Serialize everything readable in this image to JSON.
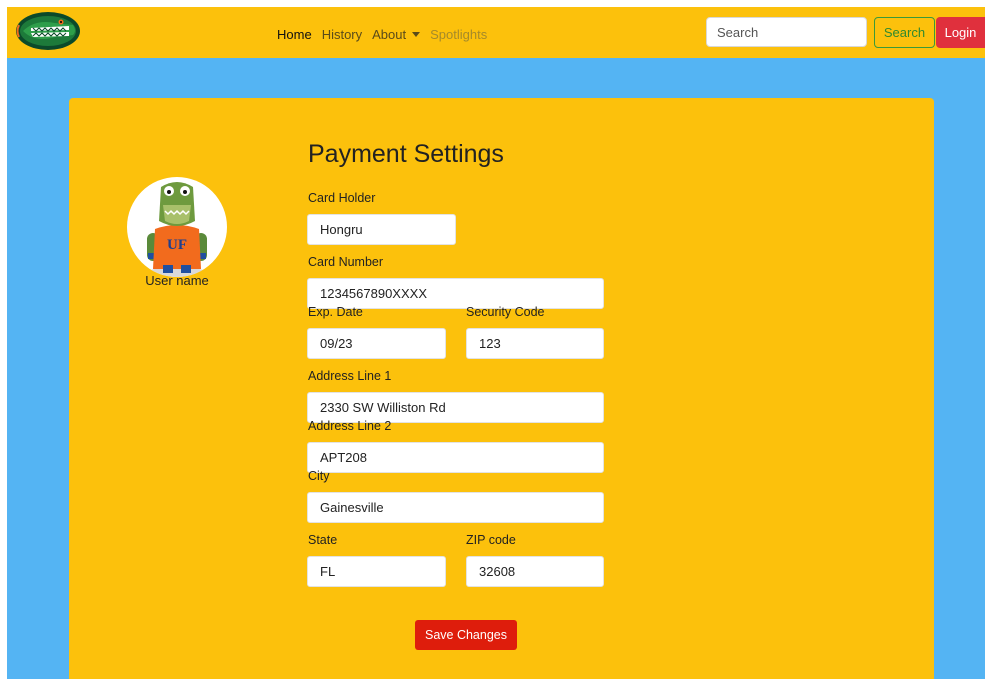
{
  "navbar": {
    "links": {
      "home": "Home",
      "history": "History",
      "about": "About",
      "spotlights": "Spotlights"
    },
    "search_placeholder": "Search",
    "search_label": "Search",
    "login_label": "Login"
  },
  "profile": {
    "username": "User name",
    "shirt_text": "UF"
  },
  "form": {
    "title": "Payment Settings",
    "card_holder": {
      "label": "Card Holder",
      "value": "Hongru"
    },
    "card_number": {
      "label": "Card Number",
      "value": "1234567890XXXX"
    },
    "exp_date": {
      "label": "Exp. Date",
      "value": "09/23"
    },
    "security_code": {
      "label": "Security Code",
      "value": "123"
    },
    "address_line1": {
      "label": "Address Line 1",
      "value": "2330 SW Williston Rd"
    },
    "address_line2": {
      "label": "Address Line 2",
      "value": "APT208"
    },
    "city": {
      "label": "City",
      "value": "Gainesville"
    },
    "state": {
      "label": "State",
      "value": "FL"
    },
    "zip": {
      "label": "ZIP code",
      "value": "32608"
    },
    "save_label": "Save Changes"
  },
  "colors": {
    "page_background": "#54b4f3",
    "navbar": "#fcc10c",
    "card": "#fcc10c",
    "save_button": "#de1d0c",
    "login_button": "#e0303d",
    "search_button_border": "#3a9a3a"
  }
}
